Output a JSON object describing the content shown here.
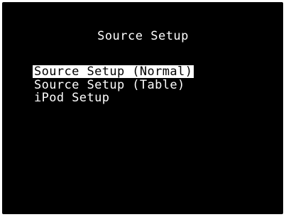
{
  "screen": {
    "title": "Source Setup",
    "menu": {
      "items": [
        {
          "label": "Source Setup (Normal)",
          "selected": true
        },
        {
          "label": "Source Setup (Table)",
          "selected": false
        },
        {
          "label": "iPod Setup",
          "selected": false
        }
      ]
    }
  },
  "colors": {
    "background": "#000000",
    "text": "#ffffff",
    "highlight_bg": "#ffffff",
    "highlight_text": "#000000"
  }
}
